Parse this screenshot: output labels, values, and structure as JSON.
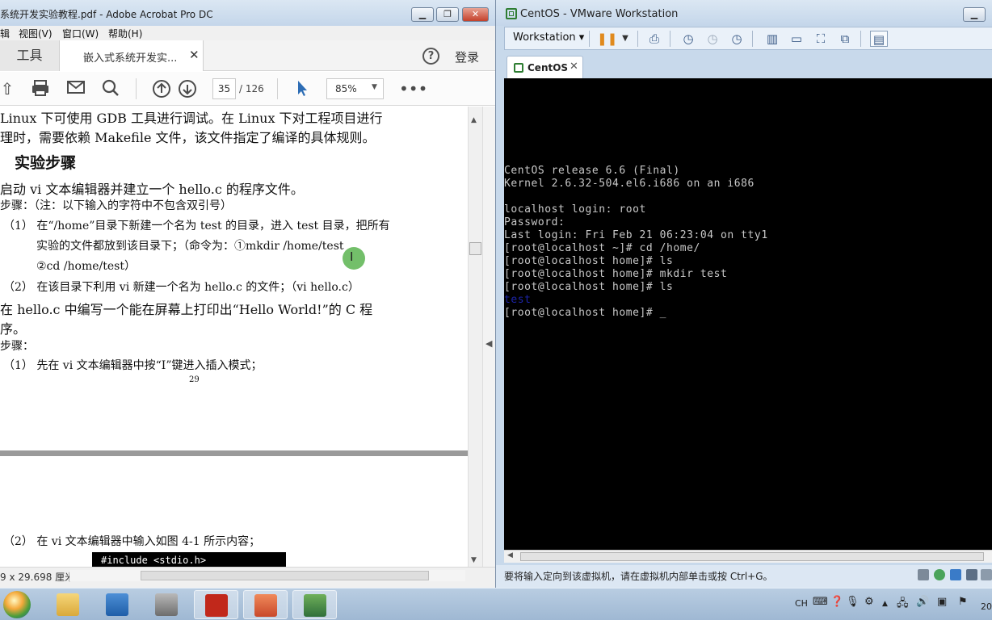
{
  "acrobat": {
    "title": "系统开发实验教程.pdf - Adobe Acrobat Pro DC",
    "menu": [
      "辑",
      "视图(V)",
      "窗口(W)",
      "帮助(H)"
    ],
    "tools_tab": "工具",
    "doc_tab": "嵌入式系统开发实...",
    "login": "登录",
    "page_current": "35",
    "page_total": "/ 126",
    "zoom": "85%",
    "status_dim": "9 x 29.698 厘米",
    "doc_lines": [
      "Linux 下可使用 GDB 工具进行调试。在 Linux 下对工程项目进行",
      "理时，需要依赖 Makefile 文件，该文件指定了编译的具体规则。",
      "实验步骤",
      "启动 vi 文本编辑器并建立一个 hello.c 的程序文件。",
      "步骤：（注：以下输入的字符中不包含双引号）",
      "（1）  在“/home”目录下新建一个名为 test 的目录，进入 test 目录，把所有",
      "实验的文件都放到该目录下；（命令为：①mkdir /home/test",
      "②cd /home/test）",
      "（2）  在该目录下利用 vi 新建一个名为 hello.c 的文件；（vi hello.c）",
      "在 hello.c 中编写一个能在屏幕上打印出“Hello World!”的 C 程",
      "序。",
      "步骤：",
      "（1）  先在 vi 文本编辑器中按“I”键进入插入模式；",
      "29",
      "（2）  在 vi 文本编辑器中输入如图 4-1 所示内容；",
      "#include <stdio.h>"
    ]
  },
  "vmware": {
    "title": "CentOS - VMware Workstation",
    "workstation_menu": "Workstation",
    "tab": "CentOS",
    "terminal": [
      "CentOS release 6.6 (Final)",
      "Kernel 2.6.32-504.el6.i686 on an i686",
      "",
      "localhost login: root",
      "Password:",
      "Last login: Fri Feb 21 06:23:04 on tty1",
      "[root@localhost ~]# cd /home/",
      "[root@localhost home]# ls",
      "[root@localhost home]# mkdir test",
      "[root@localhost home]# ls",
      "test",
      "[root@localhost home]# _"
    ],
    "status": "要将输入定向到该虚拟机，请在虚拟机内部单击或按 Ctrl+G。"
  },
  "taskbar": {
    "apps": [
      "windows-explorer",
      "ap2",
      "archive-tool",
      "adobe-acrobat",
      "powerpoint",
      "vmware"
    ],
    "tray_lang": "CH",
    "clock_partial": "20"
  },
  "colors": {
    "terminal_bg": "#000000",
    "terminal_fg": "#c8c8c8",
    "terminal_dir": "#1c24a8",
    "cursor_highlight": "#5ab450"
  }
}
